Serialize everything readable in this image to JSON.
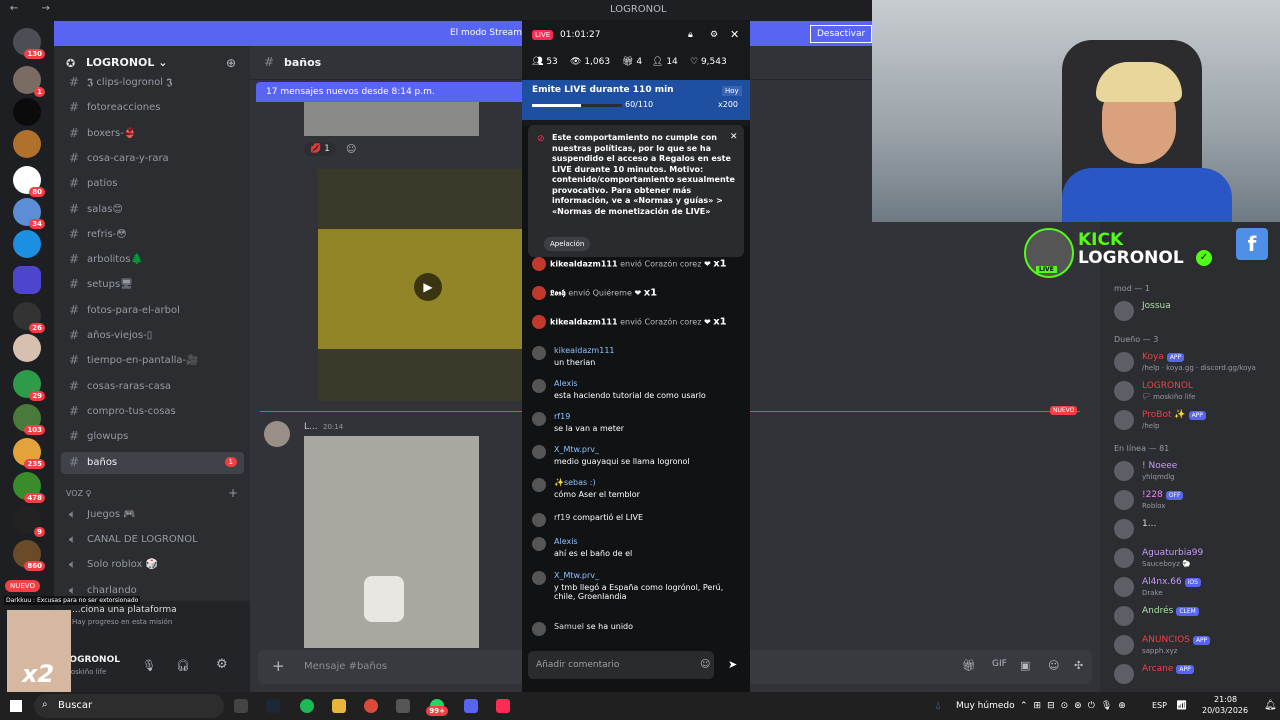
{
  "window_title": "LOGRONOL",
  "streamer_banner": {
    "text": "El modo Streamer ... nombres de usuario ... forma parcial.",
    "button": "Desactivar"
  },
  "server_rail": {
    "badges": [
      "130",
      "1",
      "80",
      "34",
      "26",
      "29",
      "103",
      "235",
      "478",
      "9",
      "860"
    ],
    "new_label": "NUEVO"
  },
  "sidebar": {
    "guild": "LOGRONOL",
    "channels": [
      {
        "name": "𝕵 clips-logronol 𝕵"
      },
      {
        "name": "fotoreacciones"
      },
      {
        "name": "boxers-👙"
      },
      {
        "name": "cosa-cara-y-rara"
      },
      {
        "name": "patios"
      },
      {
        "name": "salas😊"
      },
      {
        "name": "refris-😳"
      },
      {
        "name": "arbolitos🌲"
      },
      {
        "name": "setups🖥"
      },
      {
        "name": "fotos-para-el-arbol"
      },
      {
        "name": "años-viejos-▯"
      },
      {
        "name": "tiempo-en-pantalla-🎥"
      },
      {
        "name": "cosas-raras-casa"
      },
      {
        "name": "compro-tus-cosas"
      },
      {
        "name": "glowups"
      },
      {
        "name": "baños",
        "unread": "1"
      }
    ],
    "voice_header": "VOZ ♀",
    "voice_channels": [
      "Juegos 🎮",
      "CANAL DE LOGRONOL",
      "Solo roblox 🎲",
      "charlando"
    ],
    "user": {
      "name": "LOGRONOL",
      "status": "moskiño life"
    },
    "mission": {
      "title": "...ciona una plataforma",
      "sub": "Hay progreso en esta misión"
    },
    "overlay_caption": "Darkkuu : Excusas para no ser extorsionado",
    "combo": "x2"
  },
  "chat": {
    "channel": "baños",
    "new_messages": "17 mensajes nuevos desde 8:14 p.m.",
    "reaction_count": "1",
    "message_author": "L...",
    "message_time": "20:14",
    "new_label": "NUEVO",
    "composer_placeholder": "Mensaje #baños"
  },
  "live": {
    "live_label": "LIVE",
    "timer": "01:01:27",
    "stats": {
      "viewers": "53",
      "views": "1,063",
      "gifts": "4",
      "follows": "14",
      "likes": "9,543"
    },
    "goal_title": "Emite LIVE durante 110 min",
    "goal_tag": "Hoy",
    "goal_progress": "60/110",
    "goal_reward": "x200",
    "notice": "Este comportamiento no cumple con nuestras políticas, por lo que se ha suspendido el acceso a Regalos en este LIVE durante 10 minutos. Motivo: contenido/comportamiento sexualmente provocativo. Para obtener más información, ve a «Normas y guías» > «Normas de monetización de LIVE»",
    "appeal": "Apelación",
    "gifts": [
      {
        "user": "kikealdazm111",
        "text": "envió Corazón corez",
        "count": "x1"
      },
      {
        "user": "𝕷𝖔𝖘𝖍",
        "text": "envió Quiéreme",
        "count": "x1"
      },
      {
        "user": "kikealdazm111",
        "text": "envió Corazón corez",
        "count": "x1"
      }
    ],
    "messages": [
      {
        "user": "kikealdazm111",
        "text": "un therian"
      },
      {
        "user": "Alexis",
        "text": "esta haciendo tutorial de como usarlo"
      },
      {
        "user": "rf19",
        "text": "se la van a meter"
      },
      {
        "user": "X_Mtw.prv_",
        "text": "medio guayaqui se llama logronol"
      },
      {
        "user": "✨sebas :)",
        "text": "cómo Aser el temblor"
      },
      {
        "user": "rf19",
        "text": "compartió el LIVE"
      },
      {
        "user": "Alexis",
        "text": "ahí es el baño de el"
      },
      {
        "user": "X_Mtw.prv_",
        "text": "y tmb llegó a España como logrónol, Perú, chile, Groenlandia"
      },
      {
        "user": "Samuel",
        "text": "se ha unido"
      }
    ],
    "input_placeholder": "Añadir comentario"
  },
  "kick_overlay": {
    "brand": "KICK",
    "name": "LOGRONOL",
    "live": "LIVE"
  },
  "members": {
    "sections": [
      {
        "title": "mod — 1",
        "items": [
          {
            "name": "Jossua",
            "color": "#a8e0a0"
          }
        ]
      },
      {
        "title": "Dueño — 3",
        "items": [
          {
            "name": "Koya",
            "sub": "/help · koya.gg · discord.gg/koya",
            "tag": "APP",
            "color": "#f23f43"
          },
          {
            "name": "LOGRONOL",
            "sub": "🏳 moskiño life",
            "color": "#f23f43"
          },
          {
            "name": "ProBot ✨",
            "sub": "/help",
            "tag": "APP",
            "color": "#f23f43"
          }
        ]
      },
      {
        "title": "En línea — 81",
        "items": [
          {
            "name": "! Noeee",
            "sub": "yhlqmdlg",
            "color": "#c79bff"
          },
          {
            "name": "!228",
            "sub": "Roblox",
            "tag": "OFF",
            "color": "#f47fff"
          },
          {
            "name": "1...",
            "sub": "",
            "color": "#dbdee1"
          },
          {
            "name": "Aguaturbia99",
            "sub": "Sauceboyz 🐑",
            "color": "#c79bff"
          },
          {
            "name": "Al4nx.66",
            "sub": "Drake",
            "tag": "iOS",
            "color": "#c79bff"
          },
          {
            "name": "Andrés",
            "sub": "",
            "tag": "CLEM",
            "color": "#a8e0a0"
          },
          {
            "name": "ANUNCIOS",
            "sub": "sapph.xyz",
            "tag": "APP",
            "color": "#f23f43"
          },
          {
            "name": "Arcane",
            "sub": "",
            "tag": "APP",
            "color": "#f23f43"
          }
        ]
      }
    ]
  },
  "taskbar": {
    "search": "Buscar",
    "weather": "Muy húmedo",
    "lang": "ESP",
    "time": "21:08",
    "date": "20/03/2026",
    "whatsapp_badge": "99+"
  }
}
